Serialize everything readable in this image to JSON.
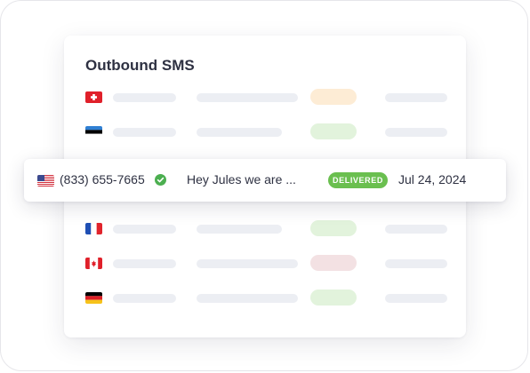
{
  "card": {
    "title": "Outbound SMS"
  },
  "rows": [
    {
      "country": "switzerland",
      "status_color": "#fdecd5"
    },
    {
      "country": "estonia",
      "status_color": "#e2f3dc"
    },
    {
      "country": "france",
      "status_color": "#e2f3dc"
    },
    {
      "country": "canada",
      "status_color": "#f3e1e3"
    },
    {
      "country": "germany",
      "status_color": "#e2f3dc"
    }
  ],
  "highlighted_row": {
    "country": "united-states",
    "phone": "(833) 655-7665",
    "verified_icon": "check-circle-icon",
    "message": "Hey Jules we are ...",
    "status": "DELIVERED",
    "status_color": "#6abf4f",
    "date": "Jul 24, 2024"
  },
  "colors": {
    "placeholder": "#eceef3",
    "text": "#2e3142",
    "verified": "#4caf50"
  }
}
